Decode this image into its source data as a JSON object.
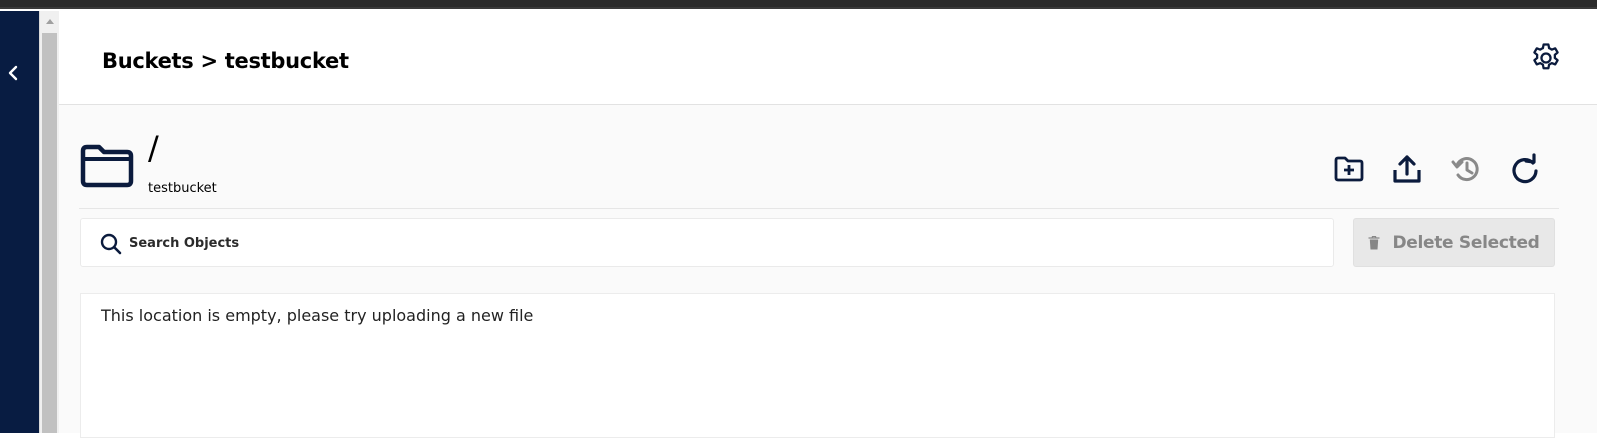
{
  "header": {
    "breadcrumb": "Buckets > testbucket"
  },
  "folder": {
    "path": "/",
    "bucket": "testbucket"
  },
  "actions": {
    "icons": [
      "create-folder-icon",
      "upload-icon",
      "history-icon",
      "refresh-icon"
    ]
  },
  "search": {
    "placeholder": "Search Objects"
  },
  "delete_button": {
    "label": "Delete Selected"
  },
  "content": {
    "empty_message": "This location is empty, please try uploading a new file"
  },
  "colors": {
    "sidebar": "#081c42",
    "icon_dark": "#0b1b3d",
    "icon_disabled": "#8a8a8a",
    "delete_bg": "#e8e8e8"
  }
}
